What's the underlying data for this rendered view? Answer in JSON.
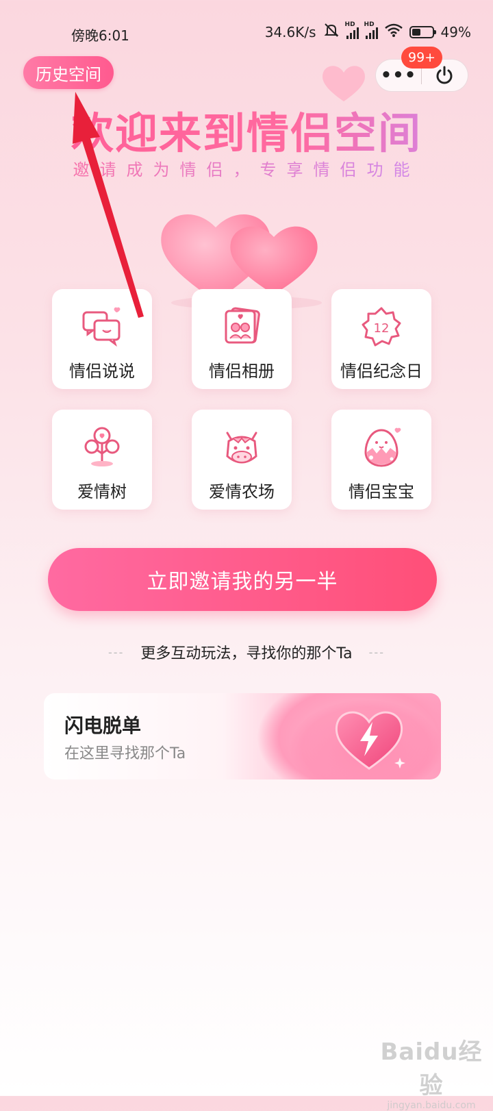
{
  "status_bar": {
    "time": "傍晚6:01",
    "speed": "34.6K/s",
    "hd1": "HD",
    "hd2": "HD",
    "battery": "49%"
  },
  "header": {
    "history_label": "历史空间",
    "badge": "99+",
    "more_label": "•••"
  },
  "hero": {
    "title": "欢迎来到情侣空间",
    "subtitle": "邀请成为情侣，专享情侣功能"
  },
  "features": [
    {
      "label": "情侣说说",
      "icon": "chat-bubbles-icon"
    },
    {
      "label": "情侣相册",
      "icon": "photo-album-icon"
    },
    {
      "label": "情侣纪念日",
      "icon": "calendar-badge-icon"
    },
    {
      "label": "爱情树",
      "icon": "love-tree-icon"
    },
    {
      "label": "爱情农场",
      "icon": "cow-icon"
    },
    {
      "label": "情侣宝宝",
      "icon": "egg-baby-icon"
    }
  ],
  "anniversary_number": "12",
  "cta_label": "立即邀请我的另一半",
  "more_play": {
    "text": "更多互动玩法，寻找你的那个Ta",
    "dash": "---"
  },
  "banner": {
    "title": "闪电脱单",
    "subtitle": "在这里寻找那个Ta"
  },
  "watermark": {
    "logo": "Baidu经验",
    "url": "jingyan.baidu.com"
  },
  "colors": {
    "accent": "#ff5a8f",
    "badge": "#ff4a3d",
    "annotation": "#e8203a"
  }
}
